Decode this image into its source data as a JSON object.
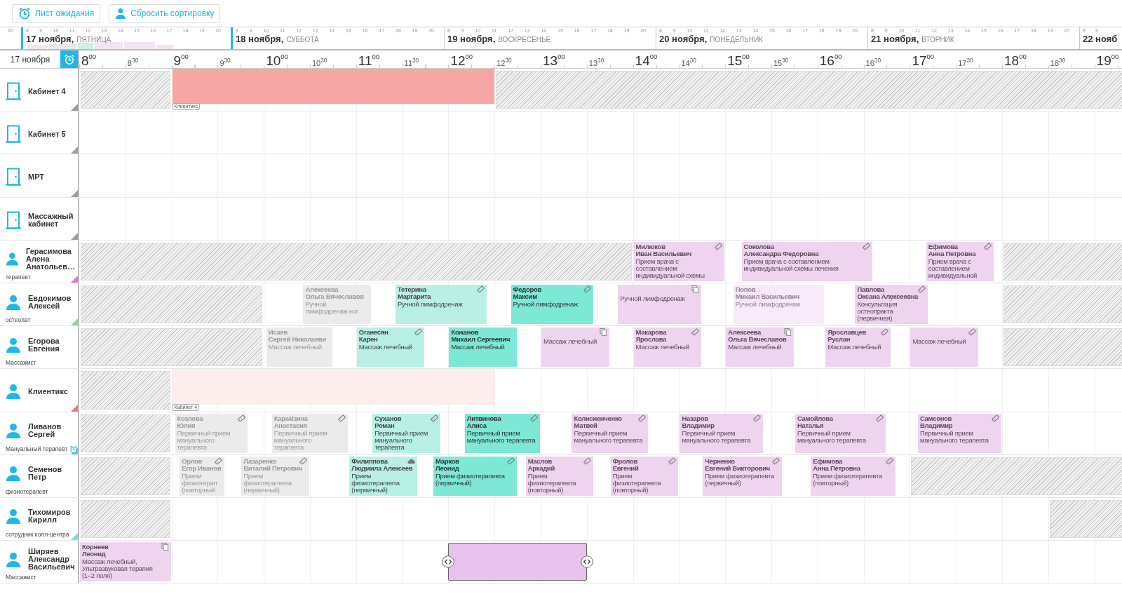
{
  "toolbar": {
    "buttons": [
      {
        "label": "Лист ожидания",
        "kind": "alarm"
      },
      {
        "label": "Сбросить сортировку",
        "kind": "person"
      }
    ]
  },
  "date_strip": {
    "previous_hours": [
      "20"
    ],
    "days": [
      {
        "date": "17 ноября,",
        "weekday": "ПЯТНИЦА",
        "selected": true,
        "hours": [
          "8",
          "9",
          "10",
          "11",
          "12",
          "13",
          "14",
          "15",
          "16",
          "17",
          "18",
          "19",
          "20"
        ]
      },
      {
        "date": "18 ноября,",
        "weekday": "СУББОТА",
        "selected": false,
        "hours": [
          "8",
          "9",
          "10",
          "11",
          "12",
          "13",
          "14",
          "15",
          "16",
          "17",
          "18",
          "19",
          "20"
        ]
      },
      {
        "date": "19 ноября,",
        "weekday": "ВОСКРЕСЕНЬЕ",
        "selected": false,
        "hours": [
          "8",
          "9",
          "10",
          "11",
          "12",
          "13",
          "14",
          "15",
          "16",
          "17",
          "18",
          "19",
          "20"
        ]
      },
      {
        "date": "20 ноября,",
        "weekday": "ПОНЕДЕЛЬНИК",
        "selected": false,
        "hours": [
          "8",
          "9",
          "10",
          "11",
          "12",
          "13",
          "14",
          "15",
          "16",
          "17",
          "18",
          "19",
          "20"
        ]
      },
      {
        "date": "21 ноября,",
        "weekday": "ВТОРНИК",
        "selected": false,
        "hours": [
          "8",
          "9",
          "10",
          "11",
          "12",
          "13",
          "14",
          "15",
          "16",
          "17",
          "18",
          "19",
          "20"
        ]
      },
      {
        "date": "22 нояб",
        "selected": false,
        "hours": [
          "8",
          "9"
        ]
      }
    ]
  },
  "timeline": {
    "date": "17 ноября",
    "ticks": [
      {
        "label": "8$^{00}$",
        "kind": "hour"
      },
      {
        "label": "8$^{30}$",
        "kind": "half"
      },
      {
        "label": "9$^{00}$",
        "kind": "hour"
      },
      {
        "label": "9$^{30}$",
        "kind": "half"
      },
      {
        "label": "10$^{00}$",
        "kind": "hour"
      },
      {
        "label": "10$^{30}$",
        "kind": "half"
      },
      {
        "label": "11$^{00}$",
        "kind": "hour"
      },
      {
        "label": "11$^{30}$",
        "kind": "half"
      },
      {
        "label": "12$^{00}$",
        "kind": "hour"
      },
      {
        "label": "12$^{30}$",
        "kind": "half"
      },
      {
        "label": "13$^{00}$",
        "kind": "hour"
      },
      {
        "label": "13$^{30}$",
        "kind": "half"
      },
      {
        "label": "14$^{00}$",
        "kind": "hour"
      },
      {
        "label": "14$^{30}$",
        "kind": "half"
      },
      {
        "label": "15$^{00}$",
        "kind": "hour"
      },
      {
        "label": "15$^{30}$",
        "kind": "half"
      },
      {
        "label": "16$^{00}$",
        "kind": "hour"
      },
      {
        "label": "16$^{30}$",
        "kind": "half"
      },
      {
        "label": "17$^{00}$",
        "kind": "hour"
      },
      {
        "label": "17$^{30}$",
        "kind": "half"
      },
      {
        "label": "18$^{00}$",
        "kind": "hour"
      },
      {
        "label": "18$^{30}$",
        "kind": "half"
      },
      {
        "label": "19$^{00}$",
        "kind": "hour"
      }
    ]
  },
  "rows": [
    {
      "kind": "room",
      "name": "Кабинет 4",
      "color": "#9e9e9e",
      "alarm": false,
      "blocks": [
        {
          "kind": "blocked"
        },
        {
          "kind": "occupied",
          "tag": "Клиентикс"
        },
        {
          "kind": "blocked"
        }
      ]
    },
    {
      "kind": "room",
      "name": "Кабинет 5",
      "color": "#9e9e9e",
      "alarm": false,
      "blocks": []
    },
    {
      "kind": "room",
      "name": "МРТ",
      "color": "#9e9e9e",
      "alarm": false,
      "blocks": []
    },
    {
      "kind": "room",
      "name": "Массажный\nкабинет",
      "color": "#9e9e9e",
      "alarm": false,
      "blocks": []
    },
    {
      "kind": "staff",
      "name": "Герасимова\nАлена\nАнатольев…",
      "role": "терапевт",
      "color": "#f06ae8",
      "alarm": false,
      "blocks": [
        {
          "kind": "blocked"
        },
        {
          "kind": "planned",
          "badge": {
            "kind": "ticket"
          },
          "surname": "Милюков",
          "given_name": "Иван Васильевич",
          "service": "Прием врача с\nсоставлением\nиндивидуальной схемы"
        },
        {
          "kind": "planned",
          "badge": {
            "kind": "ticket"
          },
          "surname": "Соколова",
          "given_name": "Александра Федоровна",
          "service": "Прием врача с составлением\nиндивидуальной схемы лечения"
        },
        {
          "kind": "planned",
          "badge": {
            "kind": "ticket"
          },
          "surname": "Ефимова",
          "given_name": "Анна Петровна",
          "service": "Прием врача с\nсоставлением\nиндивидуальной"
        },
        {
          "kind": "blocked"
        }
      ]
    },
    {
      "kind": "staff",
      "name": "Евдокимов\nАлексей",
      "role": "остеопат",
      "color": "#7ee07e",
      "alarm": false,
      "blocks": [
        {
          "kind": "blocked"
        },
        {
          "kind": "past",
          "surname": "Алексеева",
          "given_name": "Ольга Вячеславов",
          "service": "Ручной\nлимфодренаж ног"
        },
        {
          "kind": "arrived",
          "badge": {
            "kind": "ticket"
          },
          "surname": "Тетерина",
          "given_name": "Маргарита",
          "service": "Ручной лимфодренаж"
        },
        {
          "kind": "active",
          "badge": {
            "kind": "ticket"
          },
          "surname": "Федоров",
          "given_name": "Максим",
          "service": "Ручной лимфодренаж"
        },
        {
          "kind": "planned",
          "badge": {
            "kind": "copy"
          },
          "service": "Ручной лимфодренаж"
        },
        {
          "kind": "cancelled",
          "surname": "Попов",
          "given_name": "Михаил Васильевич",
          "service": "Ручной лимфодренаж"
        },
        {
          "kind": "planned",
          "badge": {
            "kind": "ticket"
          },
          "surname": "Павлова",
          "given_name": "Оксана Алексеевна",
          "service": "Консультация\nостеопракта\n(первичная)"
        },
        {
          "kind": "blocked"
        }
      ]
    },
    {
      "kind": "staff",
      "name": "Егорова\nЕвгения",
      "role": "Массажист",
      "alarm": false,
      "blocks": [
        {
          "kind": "blocked"
        },
        {
          "kind": "past",
          "surname": "Исаев",
          "given_name": "Сергей Николаеви",
          "service": "Массаж лечебный"
        },
        {
          "kind": "arrived",
          "badge": {
            "kind": "ticket"
          },
          "surname": "Оганесян",
          "given_name": "Карен",
          "service": "Массаж лечебный"
        },
        {
          "kind": "active",
          "surname": "Кожанов",
          "given_name": "Михаил Сергеевич",
          "service": "Массаж лечебный"
        },
        {
          "kind": "planned",
          "badge": {
            "kind": "copy"
          },
          "service": "Массаж лечебный"
        },
        {
          "kind": "planned",
          "badge": {
            "kind": "ticket"
          },
          "surname": "Макарова",
          "given_name": "Ярослава",
          "service": "Массаж лечебный"
        },
        {
          "kind": "planned",
          "badge": {
            "kind": "copy"
          },
          "surname": "Алексеева",
          "given_name": "Ольга Вячеславов",
          "service": "Массаж лечебный"
        },
        {
          "kind": "planned",
          "badge": {
            "kind": "ticket"
          },
          "surname": "Ярославцев",
          "given_name": "Руслан",
          "service": "Массаж лечебный"
        },
        {
          "kind": "planned",
          "badge": {
            "kind": "ticket"
          },
          "service": "Массаж лечебный"
        },
        {
          "kind": "blocked"
        }
      ]
    },
    {
      "kind": "staff",
      "name": "Клиентикс",
      "color": "#f07878",
      "alarm": false,
      "blocks": [
        {
          "kind": "blocked"
        },
        {
          "kind": "reserved",
          "tag": "Кабинет 4"
        }
      ]
    },
    {
      "kind": "staff",
      "name": "Ливанов\nСергей",
      "role": "Мануальный терапевт",
      "color": "#8cb8f0",
      "alarm": true,
      "blocks": [
        {
          "kind": "blocked"
        },
        {
          "kind": "past",
          "badge": {
            "kind": "ticket"
          },
          "surname": "Козлова",
          "given_name": "Юлия",
          "service": "Первичный прием\nмануального\nтерапевта"
        },
        {
          "kind": "past",
          "badge": {
            "kind": "ticket"
          },
          "surname": "Карамзина",
          "given_name": "Анастасия",
          "service": "Первичный прием\nмануального\nтерапевта"
        },
        {
          "kind": "arrived",
          "badge": {
            "kind": "ticket"
          },
          "surname": "Суханов",
          "given_name": "Роман",
          "service": "Первичный прием\nмануального\nтерапевта"
        },
        {
          "kind": "active",
          "badge": {
            "kind": "ticket"
          },
          "surname": "Литвинова",
          "given_name": "Алиса",
          "service": "Первичный прием\nмануального терапевта"
        },
        {
          "kind": "planned",
          "badge": {
            "kind": "ticket"
          },
          "surname": "Колисненченко",
          "given_name": "Матвей",
          "service": "Первичный прием\nмануального терапевта"
        },
        {
          "kind": "planned",
          "badge": {
            "kind": "ticket"
          },
          "surname": "Назаров",
          "given_name": "Владимир",
          "service": "Первичный прием\nмануального терапевта"
        },
        {
          "kind": "planned",
          "badge": {
            "kind": "ticket"
          },
          "surname": "Самойлова",
          "given_name": "Наталья",
          "service": "Первичный прием\nмануального терапевта"
        },
        {
          "kind": "planned",
          "badge": {
            "kind": "ticket"
          },
          "surname": "Самсонов",
          "given_name": "Владимир",
          "service": "Первичный прием\nмануального терапевта"
        }
      ]
    },
    {
      "kind": "staff",
      "name": "Семенов\nПетр",
      "role": "физиотерапевт",
      "alarm": false,
      "blocks": [
        {
          "kind": "blocked"
        },
        {
          "kind": "past",
          "badge": {
            "kind": "ticket"
          },
          "surname": "Орлов",
          "given_name": "Егор Иванов",
          "service": "Прием\nфизиотерап\n(повторный"
        },
        {
          "kind": "past",
          "badge": {
            "kind": "ticket"
          },
          "surname": "Лазаренко",
          "given_name": "Виталий Петрович",
          "service": "Прием\nфизиотерапевта\n(первичный)"
        },
        {
          "kind": "arrived",
          "badge": {
            "kind": "cloud"
          },
          "surname": "Филиппова",
          "given_name": "Людмила Алексеев",
          "service": "Прием\nфизиотерапевта\n(первичный)"
        },
        {
          "kind": "active",
          "badge": {
            "kind": "ticket"
          },
          "surname": "Марков",
          "given_name": "Леонид",
          "service": "Прием физиотерапевта\n(первичный)"
        },
        {
          "kind": "planned",
          "badge": {
            "kind": "ticket"
          },
          "surname": "Маслов",
          "given_name": "Аркадий",
          "service": "Прием\nфизиотерапевта\n(повторный)"
        },
        {
          "kind": "planned",
          "badge": {
            "kind": "ticket"
          },
          "surname": "Фролов",
          "given_name": "Евгений",
          "service": "Прием\nфизиотерапевта\n(повторный)"
        },
        {
          "kind": "planned",
          "badge": {
            "kind": "ticket"
          },
          "surname": "Черненко",
          "given_name": "Евгений Викторович",
          "service": "Прием физиотерапевта\n(первичный)"
        },
        {
          "kind": "planned",
          "badge": {
            "kind": "ticket"
          },
          "surname": "Ефимова",
          "given_name": "Анна Петровна",
          "service": "Прием физиотерапевта\n(повторный)"
        },
        {
          "kind": "blocked"
        }
      ]
    },
    {
      "kind": "staff",
      "name": "Тихомиров\nКирилл",
      "role": "сотрудник колл-центра",
      "color": "#6ee0e0",
      "alarm": false,
      "blocks": [
        {
          "kind": "blocked"
        },
        {
          "kind": "blocked"
        }
      ]
    },
    {
      "kind": "staff",
      "name": "Ширяев\nАлександр\nВасильевич",
      "role": "Массажист",
      "alarm": false,
      "blocks": [
        {
          "kind": "planned",
          "badge": {
            "kind": "copy"
          },
          "surname": "Корнеев",
          "given_name": "Леонид",
          "service": "Массаж лечебный,\nУльтразвуковая терапия\n(1–2 поля)"
        },
        {
          "kind": "selection"
        }
      ]
    }
  ]
}
